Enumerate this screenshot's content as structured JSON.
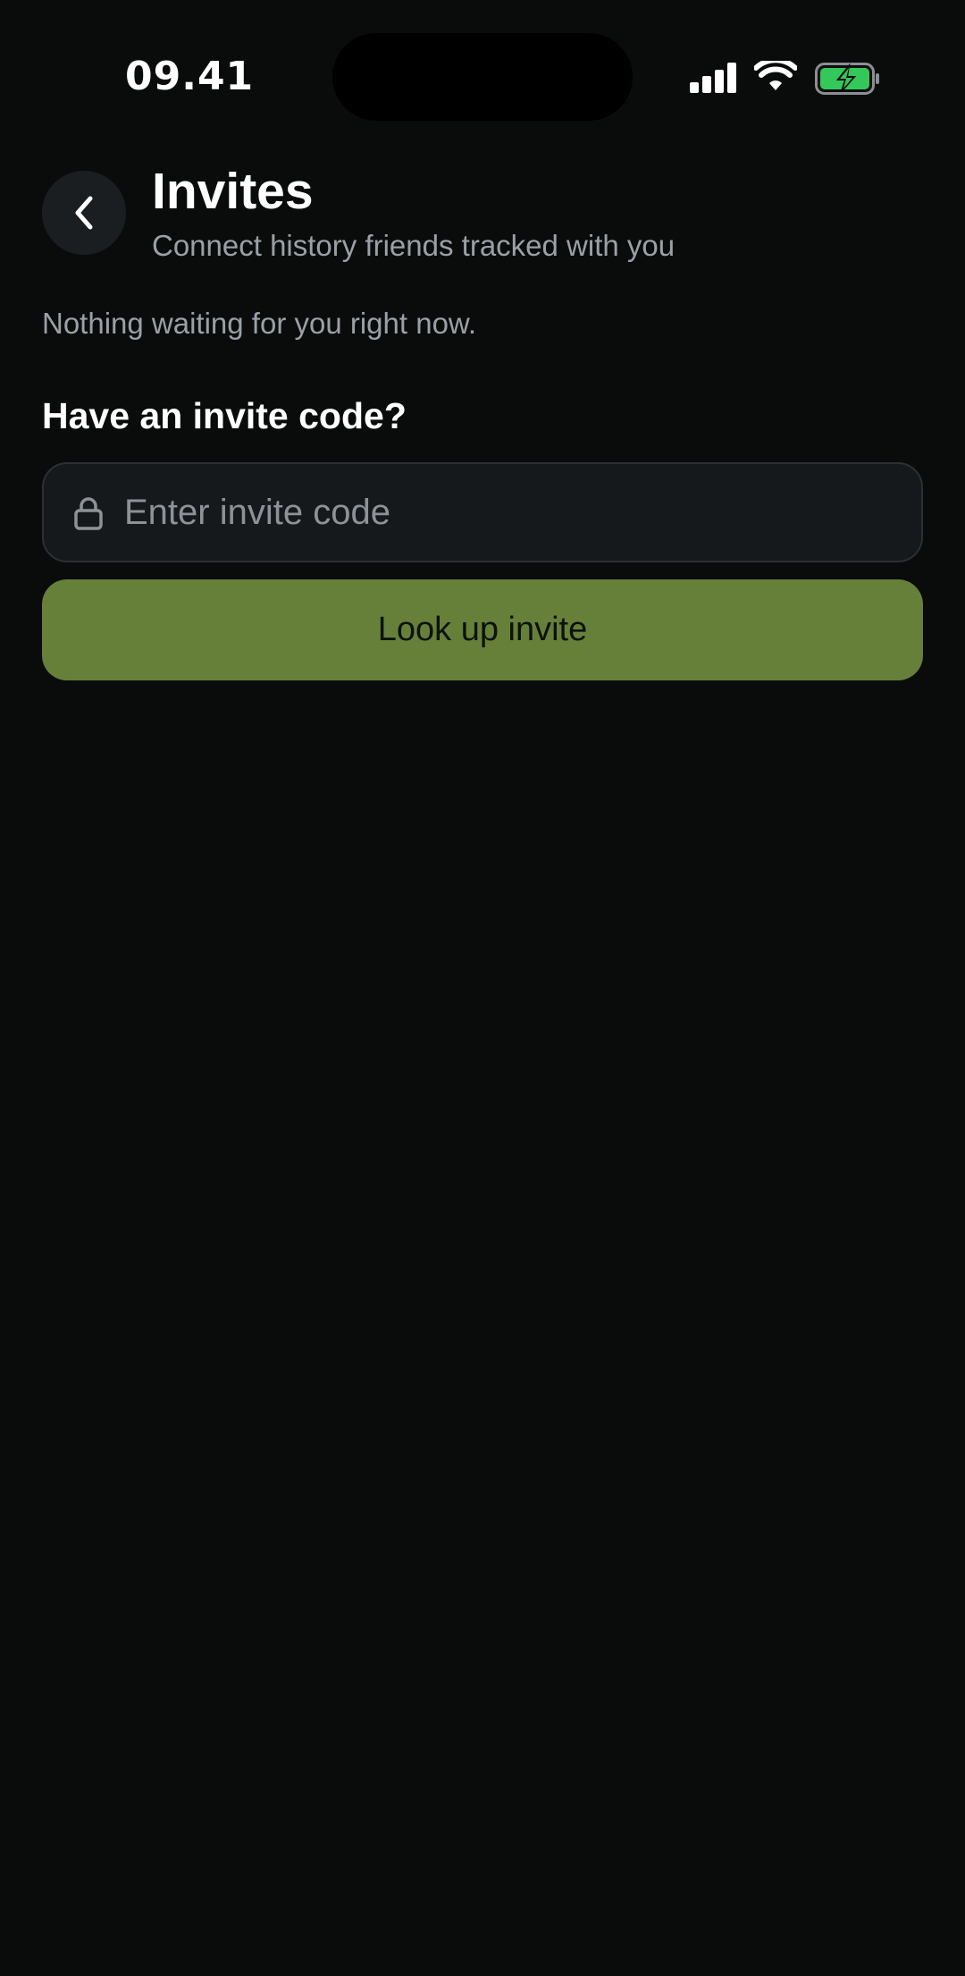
{
  "status_bar": {
    "time": "09.41",
    "icons": [
      "signal-icon",
      "wifi-icon",
      "battery-charging-icon"
    ],
    "battery_color": "#34c759"
  },
  "header": {
    "back_icon": "chevron-left-icon",
    "title": "Invites",
    "subtitle": "Connect history friends tracked with you"
  },
  "main": {
    "empty_message": "Nothing waiting for you right now.",
    "invite_section": {
      "heading": "Have an invite code?",
      "input": {
        "icon": "lock-icon",
        "value": "",
        "placeholder": "Enter invite code"
      },
      "button_label": "Look up invite"
    }
  },
  "colors": {
    "background": "#0a0c0c",
    "accent_button": "#66803a",
    "input_background": "#15191c",
    "muted_text": "#9aa0a6"
  }
}
